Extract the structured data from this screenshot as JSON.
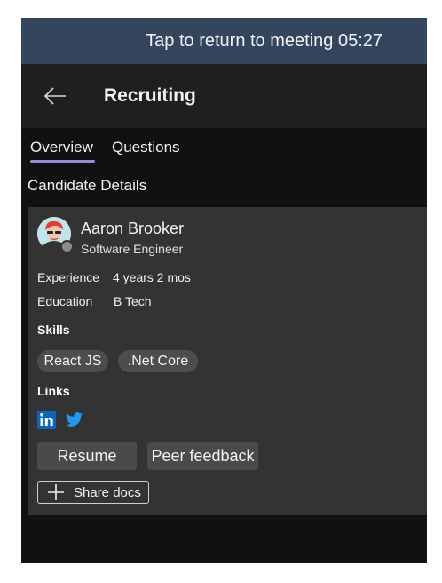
{
  "meeting_banner": {
    "text": "Tap to return to meeting 05:27"
  },
  "header": {
    "title": "Recruiting",
    "back_icon": "back-arrow-icon"
  },
  "tabs": [
    {
      "label": "Overview",
      "selected": true
    },
    {
      "label": "Questions",
      "selected": false
    }
  ],
  "section_title": "Candidate Details",
  "candidate": {
    "name": "Aaron Brooker",
    "role": "Software Engineer",
    "presence": "offline",
    "experience_label": "Experience",
    "experience_value": "4 years 2 mos",
    "education_label": "Education",
    "education_value": "B Tech",
    "skills_heading": "Skills",
    "skills": [
      "React JS",
      ".Net Core"
    ],
    "links_heading": "Links",
    "links": [
      {
        "icon": "linkedin-icon",
        "color": "#0a66c2"
      },
      {
        "icon": "twitter-icon",
        "color": "#1d9bf0"
      }
    ]
  },
  "actions": {
    "resume_label": "Resume",
    "peer_feedback_label": "Peer feedback",
    "share_docs_label": "Share docs"
  },
  "colors": {
    "banner": "#33465d",
    "header": "#1f1f1f",
    "card": "#333333",
    "tab_indicator": "#8e8cd8"
  }
}
